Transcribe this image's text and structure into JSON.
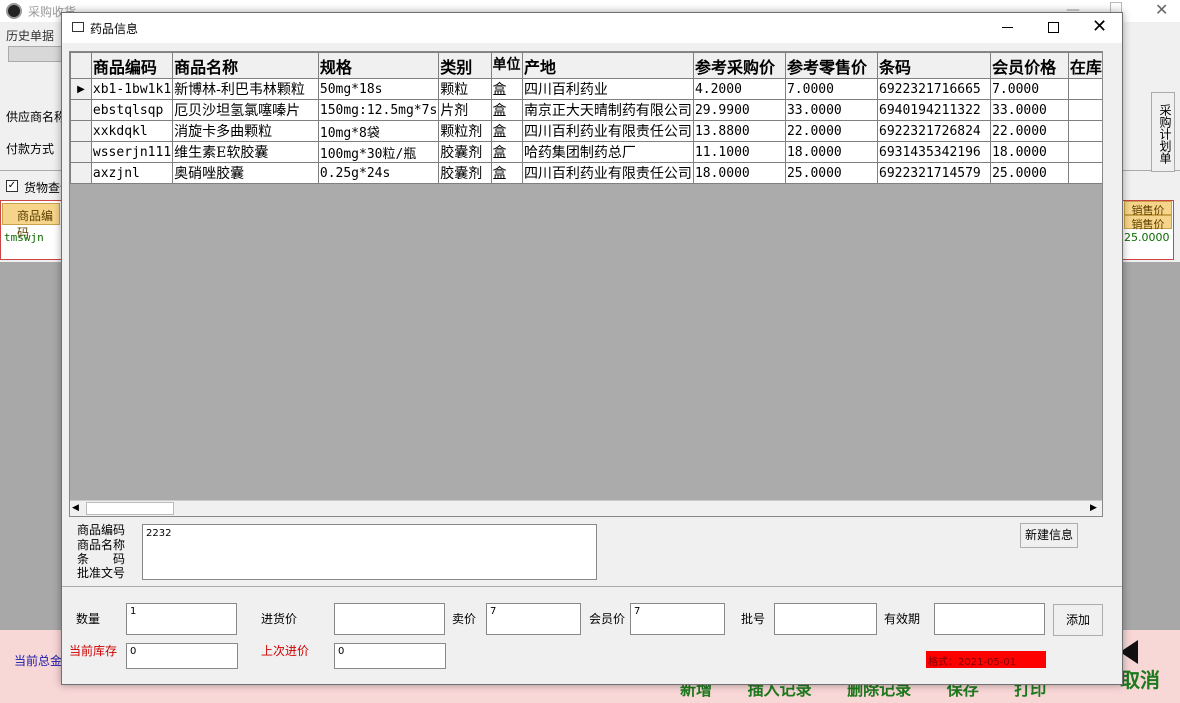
{
  "main_window": {
    "title": "采购收货",
    "menu_history": "历史单据",
    "supplier_label": "供应商名称",
    "payment_label": "付款方式",
    "goods_query_label": "货物查询",
    "grid_header_code": "商品编码",
    "grid_cell_code": "tmswjn",
    "right_header_1": "销售价",
    "right_header_2": "销售价",
    "right_value": "25.0000",
    "plan_button": "采购计划单",
    "total_label": "当前总金",
    "cancel_label": "取消",
    "bottom_actions": "新增 插入记录 删除记录 保存 打印"
  },
  "dialog": {
    "title": "药品信息",
    "grid": {
      "columns": [
        "商品编码",
        "商品名称",
        "规格",
        "类别",
        "单位",
        "产地",
        "参考采购价",
        "参考零售价",
        "条码",
        "会员价格",
        "在库"
      ],
      "rows": [
        {
          "code": "xb1-1bw1k1",
          "name": "新博林-利巴韦林颗粒",
          "spec": "50mg*18s",
          "category": "颗粒",
          "unit": "盒",
          "origin": "四川百利药业",
          "purchase_price": "4.2000",
          "retail_price": "7.0000",
          "barcode": "6922321716665",
          "member_price": "7.0000",
          "stock": ""
        },
        {
          "code": "ebstqlsqp",
          "name": "厄贝沙坦氢氯噻嗪片",
          "spec": "150mg:12.5mg*7s",
          "category": "片剂",
          "unit": "盒",
          "origin": "南京正大天晴制药有限公司",
          "purchase_price": "29.9900",
          "retail_price": "33.0000",
          "barcode": "6940194211322",
          "member_price": "33.0000",
          "stock": ""
        },
        {
          "code": "xxkdqkl",
          "name": "消旋卡多曲颗粒",
          "spec": "10mg*8袋",
          "category": "颗粒剂",
          "unit": "盒",
          "origin": "四川百利药业有限责任公司",
          "purchase_price": "13.8800",
          "retail_price": "22.0000",
          "barcode": "6922321726824",
          "member_price": "22.0000",
          "stock": ""
        },
        {
          "code": "wsserjn111",
          "name": "维生素E软胶囊",
          "spec": "100mg*30粒/瓶",
          "category": "胶囊剂",
          "unit": "盒",
          "origin": "哈药集团制药总厂",
          "purchase_price": "11.1000",
          "retail_price": "18.0000",
          "barcode": "6931435342196",
          "member_price": "18.0000",
          "stock": ""
        },
        {
          "code": "axzjnl",
          "name": "奥硝唑胶囊",
          "spec": "0.25g*24s",
          "category": "胶囊剂",
          "unit": "盒",
          "origin": "四川百利药业有限责任公司",
          "purchase_price": "18.0000",
          "retail_price": "25.0000",
          "barcode": "6922321714579",
          "member_price": "25.0000",
          "stock": ""
        }
      ]
    },
    "search": {
      "label_code": "商品编码",
      "label_name": "商品名称",
      "label_barcode": "条　　码",
      "label_approval": "批准文号",
      "value": "2232"
    },
    "new_info_button": "新建信息",
    "form": {
      "quantity_label": "数量",
      "quantity_value": "1",
      "purchase_price_label": "进货价",
      "purchase_price_value": "",
      "sale_price_label": "卖价",
      "sale_price_value": "7",
      "member_price_label": "会员价",
      "member_price_value": "7",
      "batch_label": "批号",
      "batch_value": "",
      "expiry_label": "有效期",
      "expiry_value": "",
      "add_button": "添加",
      "stock_label": "当前库存",
      "stock_value": "0",
      "last_price_label": "上次进价",
      "last_price_value": "0",
      "format_hint": "格式：2021-05-01"
    }
  }
}
